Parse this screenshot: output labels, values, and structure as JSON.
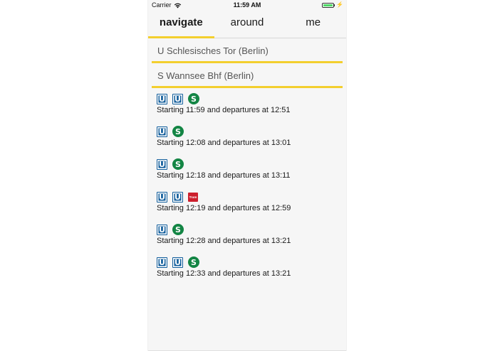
{
  "status_bar": {
    "carrier": "Carrier",
    "time": "11:59 AM",
    "battery_level": 1.0,
    "charging_symbol": "⚡"
  },
  "tabs": [
    {
      "label": "navigate",
      "active": true
    },
    {
      "label": "around",
      "active": false
    },
    {
      "label": "me",
      "active": false
    }
  ],
  "route": {
    "from": "U Schlesisches Tor (Berlin)",
    "to": "S Wannsee Bhf (Berlin)"
  },
  "line_icons": {
    "u": {
      "glyph": "U",
      "color": "#115d9b",
      "icon": "u-bahn-icon"
    },
    "s": {
      "glyph": "S",
      "color": "#138544",
      "icon": "s-bahn-icon"
    },
    "tram": {
      "glyph": "Tram",
      "color": "#cc1f2d",
      "icon": "tram-icon"
    }
  },
  "results": [
    {
      "lines": [
        "u",
        "u",
        "s"
      ],
      "text": "Starting 11:59 and departures at 12:51"
    },
    {
      "lines": [
        "u",
        "s"
      ],
      "text": "Starting 12:08 and departures at 13:01"
    },
    {
      "lines": [
        "u",
        "s"
      ],
      "text": "Starting 12:18 and departures at 13:11"
    },
    {
      "lines": [
        "u",
        "u",
        "tram"
      ],
      "text": "Starting 12:19 and departures at 12:59"
    },
    {
      "lines": [
        "u",
        "s"
      ],
      "text": "Starting 12:28 and departures at 13:21"
    },
    {
      "lines": [
        "u",
        "u",
        "s"
      ],
      "text": "Starting 12:33 and departures at 13:21"
    }
  ],
  "colors": {
    "accent": "#f3cf2e",
    "background": "#f6f6f6"
  }
}
